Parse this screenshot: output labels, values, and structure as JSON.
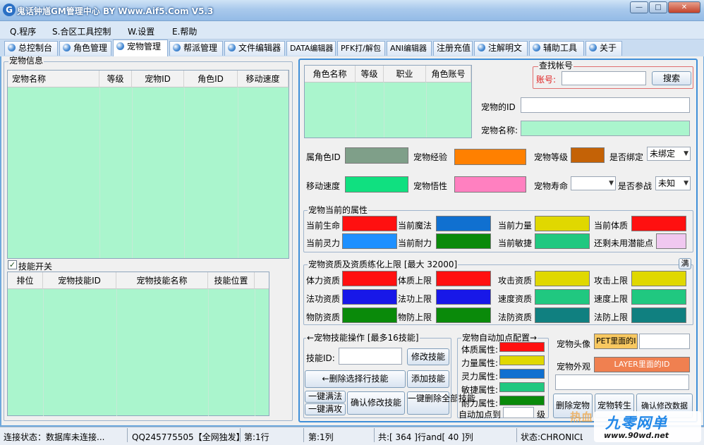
{
  "window": {
    "title": "鬼话钟馗GM管理中心 BY Www.Aif5.Com  V5.3",
    "icon": "app-logo-icon",
    "min": "—",
    "max": "□",
    "close": "✕"
  },
  "menu": [
    "Q.程序",
    "S.合区工具控制",
    "W.设置",
    "E.帮助"
  ],
  "tabs": [
    "总控制台",
    "角色管理",
    "宠物管理",
    "帮派管理",
    "文件编辑器",
    "DATA编辑器",
    "PFK打/解包",
    "ANI编辑器",
    "注册充值",
    "注解明文",
    "辅助工具",
    "关于"
  ],
  "pet_info": {
    "title": "宠物信息",
    "columns": [
      "宠物名称",
      "等级",
      "宠物ID",
      "角色ID",
      "移动速度"
    ]
  },
  "skill_switch": "技能开关",
  "skill_table": {
    "columns": [
      "排位",
      "宠物技能ID",
      "宠物技能名称",
      "技能位置"
    ]
  },
  "role_table": {
    "columns": [
      "角色名称",
      "等级",
      "职业",
      "角色账号"
    ]
  },
  "find_account": {
    "title": "查找帐号",
    "label": "账号:",
    "value": "",
    "button": "搜索"
  },
  "pet_id_label": "宠物的ID",
  "pet_name_label": "宠物名称:",
  "fields": {
    "owner_id": "属角色ID",
    "exp": "宠物经验",
    "level": "宠物等级",
    "bound": "是否绑定",
    "bound_value": "未绑定",
    "speed": "移动速度",
    "savvy": "宠物悟性",
    "life": "宠物寿命",
    "fight": "是否参战",
    "fight_value": "未知"
  },
  "colors": {
    "owner": "#7f9f89",
    "exp": "#ff8000",
    "level": "#c46206",
    "speed": "#10e080",
    "savvy": "#ff80c0",
    "red": "#ff1010",
    "blue": "#1070d0",
    "yellow": "#e0d800",
    "skyblue": "#1e90ff",
    "green": "#0a8a0a",
    "teal": "#20c880",
    "pink": "#f0c8f0",
    "purpleblue": "#1818e8",
    "darkteal": "#108080",
    "orange": "#f8c860",
    "orangered": "#f08050"
  },
  "current_attr": {
    "title": "宠物当前的属性",
    "labels": [
      "当前生命",
      "当前魔法",
      "当前力量",
      "当前体质",
      "当前灵力",
      "当前耐力",
      "当前敏捷",
      "还剩未用潜能点"
    ]
  },
  "aptitude": {
    "title": "宠物资质及资质练化上限 [最大 32000]",
    "full": "满",
    "labels": [
      "体力资质",
      "体质上限",
      "攻击资质",
      "攻击上限",
      "法功资质",
      "法功上限",
      "速度资质",
      "速度上限",
      "物防资质",
      "物防上限",
      "法防资质",
      "法防上限"
    ]
  },
  "skill_op": {
    "title": "←宠物技能操作 [最多16技能]",
    "id_label": "技能ID:",
    "modify": "修改技能",
    "delete": "←删除选择行技能",
    "add": "添加技能",
    "full1": "一键满法",
    "full2": "一键满攻",
    "confirm": "确认修改技能",
    "delall": "一键删除全部技能"
  },
  "auto_add": {
    "title": "宠物自动加点配置→",
    "labels": [
      "体质属性:",
      "力量属性:",
      "灵力属性:",
      "敏捷属性:",
      "耐力属性:"
    ],
    "auto": "自动加点到",
    "unit": "级"
  },
  "pet_look": {
    "head": "宠物头像",
    "head_value": "PET里面的I",
    "look": "宠物外观",
    "look_value": "LAYER里面的ID",
    "delete": "删除宠物",
    "rebirth": "宠物转生",
    "confirm": "确认修改数据"
  },
  "status": {
    "conn": "连接状态：数据库未连接...",
    "qq": "QQ245775505【全网独发】",
    "row": "第:1行",
    "col": "第:1列",
    "total": "共:[ 364 ]行and[ 40 ]列",
    "state": "状态:CHRONICLE"
  },
  "watermark": {
    "brand": "九零网单",
    "url": "www.90wd.net",
    "hot": "热血"
  }
}
